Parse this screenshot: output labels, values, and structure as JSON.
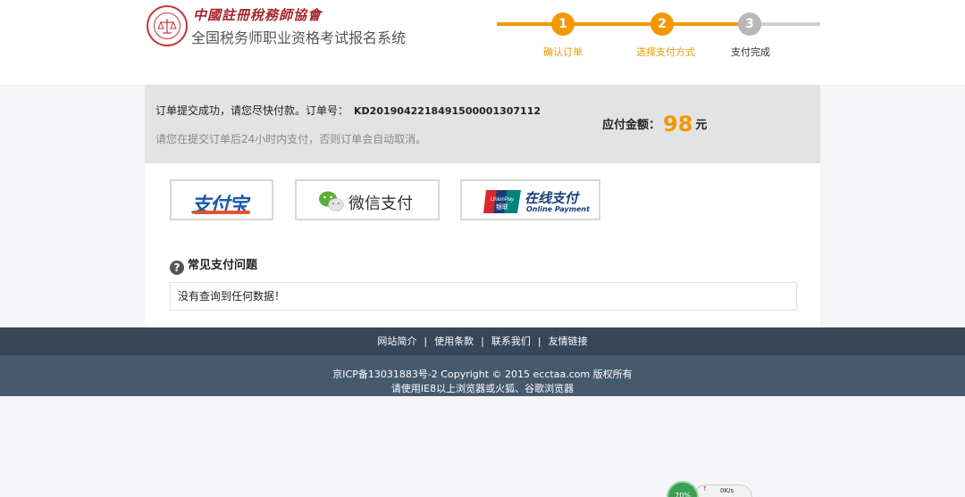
{
  "header": {
    "org_name": "中國註冊稅務師協會",
    "system_title": "全国税务师职业资格考试报名系统",
    "steps": [
      {
        "num": "1",
        "label": "确认订单"
      },
      {
        "num": "2",
        "label": "选择支付方式"
      },
      {
        "num": "3",
        "label": "支付完成"
      }
    ]
  },
  "order": {
    "success_msg": "订单提交成功，请您尽快付款。订单号：",
    "order_no": "KD2019042218491500001307112",
    "notice": "请您在提交订单后24小时内支付，否则订单会自动取消。",
    "amount_label": "应付金额：",
    "amount_value": "98",
    "amount_unit": "元"
  },
  "payment": {
    "alipay_label": "支付宝",
    "wechat_label": "微信支付",
    "union_label": "在线支付",
    "union_sub": "Online Payment",
    "union_brand": "UnionPay",
    "union_cn": "银联"
  },
  "faq": {
    "icon": "?",
    "title": "常见支付问题",
    "empty": "没有查询到任何数据！"
  },
  "footer": {
    "links": [
      "网站简介",
      "使用条款",
      "联系我们",
      "友情链接"
    ],
    "sep": "|",
    "copyright": "京ICP备13031883号-2 Copyright © 2015 ecctaa.com 版权所有",
    "browser_tip": "请使用IE8以上浏览器或火狐、谷歌浏览器"
  },
  "widget": {
    "percent": "70%",
    "speed": "0K/s",
    "arrow": "↑"
  },
  "colors": {
    "accent": "#f39800",
    "footer_dark": "#37475a",
    "footer_light": "#465a6e"
  }
}
